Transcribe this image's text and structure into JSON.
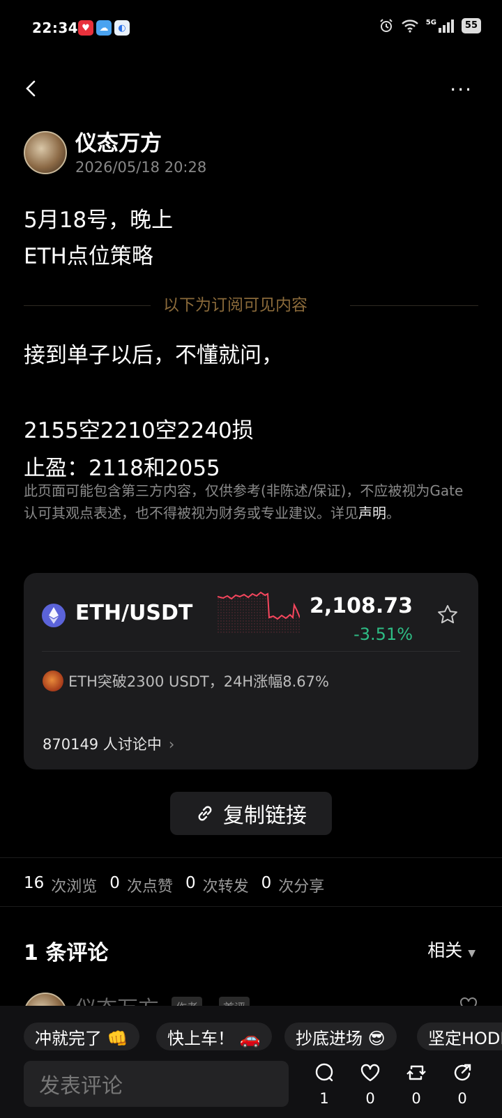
{
  "status_bar": {
    "time": "22:34",
    "battery": "55",
    "network": "5G"
  },
  "post": {
    "author": "仪态万方",
    "timestamp": "2026/05/18 20:28",
    "lines": [
      "5月18号，晚上",
      "ETH点位策略"
    ],
    "subscription_label": "以下为订阅可见内容",
    "body": [
      "接到单子以后，不懂就问，",
      "2155空2210空2240损",
      "止盈：2118和2055"
    ]
  },
  "disclaimer": {
    "text": "此页面可能包含第三方内容，仅供参考(非陈述/保证)，不应被视为Gate认可其观点表述，也不得被视为财务或专业建议。详见",
    "link": "声明",
    "end": "。"
  },
  "market_card": {
    "pair": "ETH/USDT",
    "price": "2,108.73",
    "change": "-3.51%",
    "news": "ETH突破2300 USDT，24H涨幅8.67%",
    "discussing": "870149 人讨论中",
    "colors": {
      "up": "#2ebd85",
      "down": "#f6465d"
    }
  },
  "copy_link": {
    "label": "复制链接"
  },
  "stats": [
    {
      "count": "16",
      "label": "次浏览"
    },
    {
      "count": "0",
      "label": "次点赞"
    },
    {
      "count": "0",
      "label": "次转发"
    },
    {
      "count": "0",
      "label": "次分享"
    }
  ],
  "comments": {
    "title": "1 条评论",
    "sort": "相关",
    "preview_name": "仪态万方",
    "badges": [
      "作者",
      "首评"
    ]
  },
  "quick_replies": [
    "冲就完了 👊",
    "快上车！ 🚗",
    "抄底进场 😎",
    "坚定HODL"
  ],
  "composer": {
    "placeholder": "发表评论"
  },
  "actions": [
    {
      "icon": "comment-icon",
      "count": "1"
    },
    {
      "icon": "heart-icon",
      "count": "0"
    },
    {
      "icon": "repost-icon",
      "count": "0"
    },
    {
      "icon": "share-icon",
      "count": "0"
    }
  ]
}
